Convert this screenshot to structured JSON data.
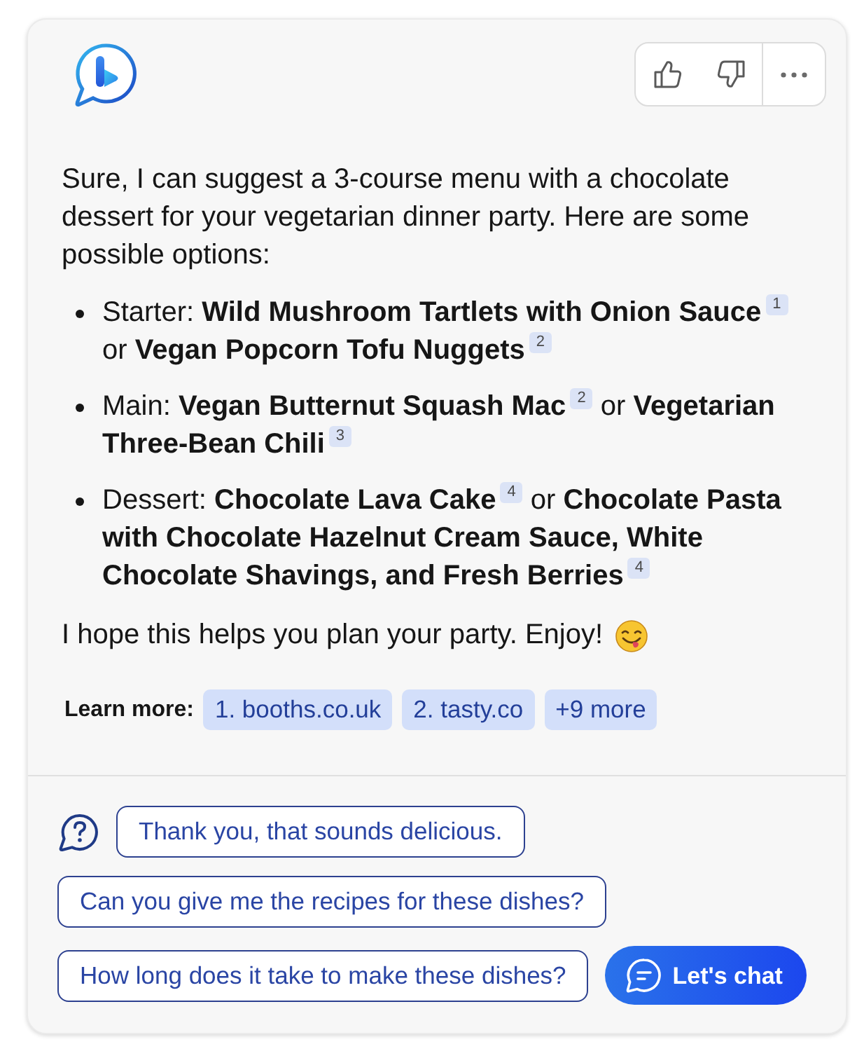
{
  "message": {
    "intro": "Sure, I can suggest a 3-course menu with a chocolate dessert for your vegetarian dinner party. Here are some possible options:",
    "courses": [
      {
        "label": "Starter:",
        "joiner": "or",
        "options": [
          {
            "dish": "Wild Mushroom Tartlets with Onion Sauce",
            "citation": "1"
          },
          {
            "dish": "Vegan Popcorn Tofu Nuggets",
            "citation": "2"
          }
        ]
      },
      {
        "label": "Main:",
        "joiner": "or",
        "options": [
          {
            "dish": "Vegan Butternut Squash Mac",
            "citation": "2"
          },
          {
            "dish": "Vegetarian Three-Bean Chili",
            "citation": "3"
          }
        ]
      },
      {
        "label": "Dessert:",
        "joiner": "or",
        "options": [
          {
            "dish": "Chocolate Lava Cake",
            "citation": "4"
          },
          {
            "dish": "Chocolate Pasta with Chocolate Hazelnut Cream Sauce, White Chocolate Shavings, and Fresh Berries",
            "citation": "4"
          }
        ]
      }
    ],
    "closing": "I hope this helps you plan your party. Enjoy!"
  },
  "learn_more": {
    "label": "Learn more:",
    "sources": [
      "1. booths.co.uk",
      "2. tasty.co",
      "+9 more"
    ]
  },
  "suggestions": [
    "Thank you, that sounds delicious.",
    "Can you give me the recipes for these dishes?",
    "How long does it take to make these dishes?"
  ],
  "chat_button": {
    "label": "Let's chat"
  }
}
